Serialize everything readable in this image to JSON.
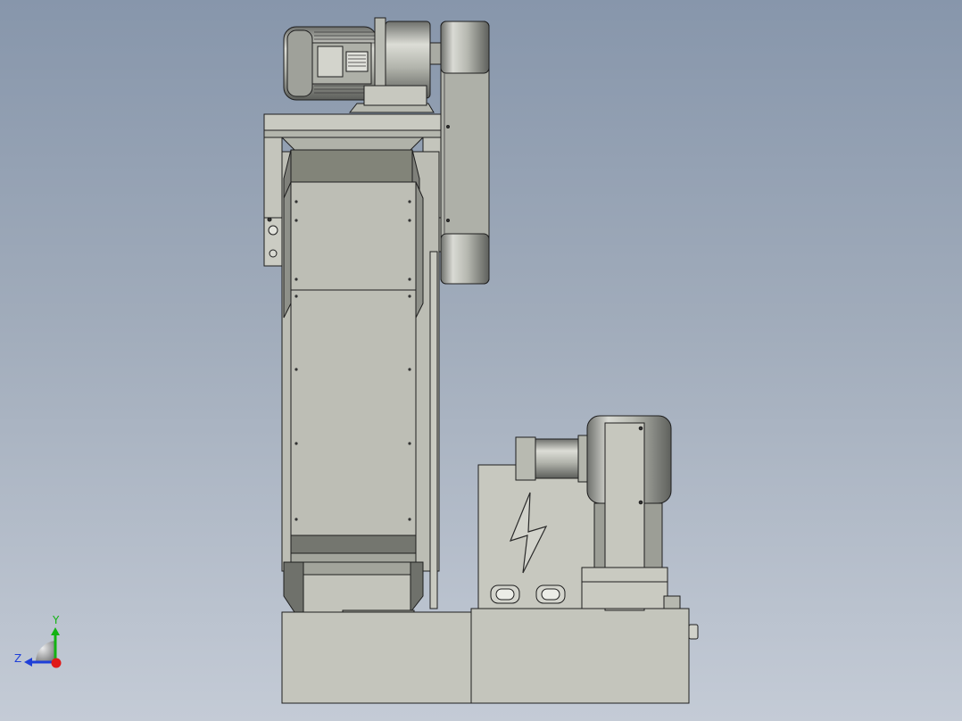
{
  "viewport": {
    "background_top": "#8796ab",
    "background_bottom": "#c4cbd6",
    "part_fill": "#c2c3b7",
    "part_fill_dark": "#80817a",
    "edge_color": "#1e1e1e"
  },
  "triad": {
    "y_label": "Y",
    "z_label": "Z",
    "y_color": "#13b313",
    "z_color": "#1e3fd8",
    "x_color": "#e01818"
  },
  "icons": [
    "lightning-bolt-icon",
    "coordinate-triad-icon"
  ]
}
